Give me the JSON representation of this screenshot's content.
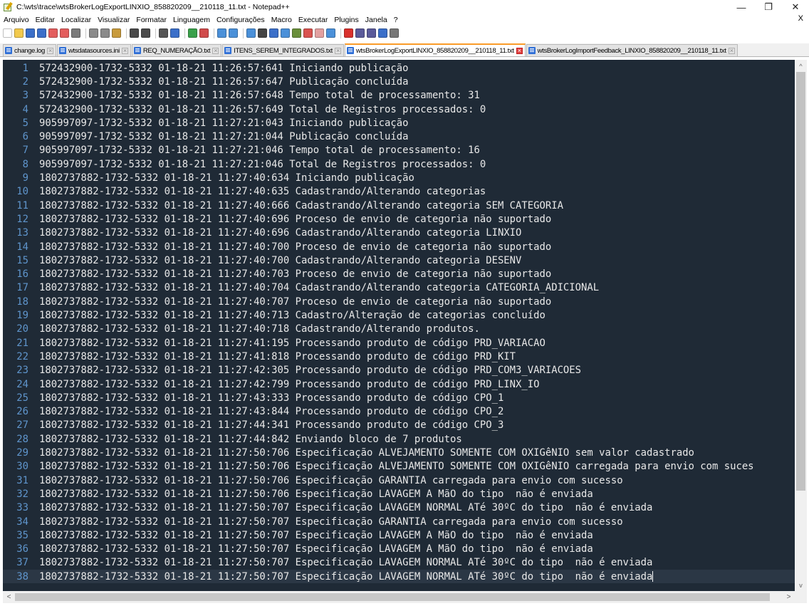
{
  "window": {
    "title": "C:\\wts\\trace\\wtsBrokerLogExportLINXIO_858820209__210118_11.txt - Notepad++",
    "minimize": "—",
    "maximize": "❐",
    "close": "✕"
  },
  "menu": {
    "items": [
      "Arquivo",
      "Editar",
      "Localizar",
      "Visualizar",
      "Formatar",
      "Linguagem",
      "Configurações",
      "Macro",
      "Executar",
      "Plugins",
      "Janela",
      "?"
    ],
    "close_doc": "X"
  },
  "toolbar": {
    "icons": [
      {
        "name": "new-file-icon",
        "color": "#ffffff"
      },
      {
        "name": "open-file-icon",
        "color": "#f2c94c"
      },
      {
        "name": "save-icon",
        "color": "#3b6fc9"
      },
      {
        "name": "save-all-icon",
        "color": "#3b6fc9"
      },
      {
        "name": "close-file-icon",
        "color": "#e35d5d"
      },
      {
        "name": "close-all-icon",
        "color": "#e35d5d"
      },
      {
        "name": "print-icon",
        "color": "#7a7a7a"
      },
      {
        "sep": true
      },
      {
        "name": "cut-icon",
        "color": "#8a8a8a"
      },
      {
        "name": "copy-icon",
        "color": "#8a8a8a"
      },
      {
        "name": "paste-icon",
        "color": "#c89b3c"
      },
      {
        "sep": true
      },
      {
        "name": "undo-icon",
        "color": "#4a4a4a"
      },
      {
        "name": "redo-icon",
        "color": "#4a4a4a"
      },
      {
        "sep": true
      },
      {
        "name": "find-icon",
        "color": "#555555"
      },
      {
        "name": "replace-icon",
        "color": "#3b6fc9"
      },
      {
        "sep": true
      },
      {
        "name": "zoom-in-icon",
        "color": "#3aa04a"
      },
      {
        "name": "zoom-out-icon",
        "color": "#d04a4a"
      },
      {
        "sep": true
      },
      {
        "name": "sync-vertical-icon",
        "color": "#4a90d9"
      },
      {
        "name": "sync-horizontal-icon",
        "color": "#4a90d9"
      },
      {
        "sep": true
      },
      {
        "name": "word-wrap-icon",
        "color": "#4a90d9"
      },
      {
        "name": "show-all-chars-icon",
        "color": "#444444"
      },
      {
        "name": "indent-guide-icon",
        "color": "#3b6fc9"
      },
      {
        "name": "language-icon",
        "color": "#4a90d9"
      },
      {
        "name": "doc-map-icon",
        "color": "#6a8f3a"
      },
      {
        "name": "function-list-icon",
        "color": "#d9534f"
      },
      {
        "name": "folder-workspace-icon",
        "color": "#e2a0a0"
      },
      {
        "name": "monitoring-icon",
        "color": "#4a90d9"
      },
      {
        "sep": true
      },
      {
        "name": "record-macro-icon",
        "color": "#d9302c"
      },
      {
        "name": "stop-macro-icon",
        "color": "#5a5a9a"
      },
      {
        "name": "play-macro-icon",
        "color": "#5a5a9a"
      },
      {
        "name": "run-macro-multiple-icon",
        "color": "#3b6fc9"
      },
      {
        "name": "save-macro-icon",
        "color": "#777777"
      }
    ]
  },
  "tabs": [
    {
      "label": "change.log",
      "active": false
    },
    {
      "label": "wtsdatasources.ini",
      "active": false
    },
    {
      "label": "REQ_NUMERAÇÃO.txt",
      "active": false
    },
    {
      "label": "ITENS_SEREM_INTEGRADOS.txt",
      "active": false
    },
    {
      "label": "wtsBrokerLogExportLINXIO_858820209__210118_11.txt",
      "active": true
    },
    {
      "label": "wtsBrokerLogImportFeedback_LINXIO_858820209__210118_11.txt",
      "active": false
    }
  ],
  "editor": {
    "current_line": 38,
    "lines": [
      {
        "n": "1",
        "text": "572432900-1732-5332 01-18-21 11:26:57:641 Iniciando publicação"
      },
      {
        "n": "2",
        "text": "572432900-1732-5332 01-18-21 11:26:57:647 Publicação concluída"
      },
      {
        "n": "3",
        "text": "572432900-1732-5332 01-18-21 11:26:57:648 Tempo total de processamento: 31"
      },
      {
        "n": "4",
        "text": "572432900-1732-5332 01-18-21 11:26:57:649 Total de Registros processados: 0"
      },
      {
        "n": "5",
        "text": "905997097-1732-5332 01-18-21 11:27:21:043 Iniciando publicação"
      },
      {
        "n": "6",
        "text": "905997097-1732-5332 01-18-21 11:27:21:044 Publicação concluída"
      },
      {
        "n": "7",
        "text": "905997097-1732-5332 01-18-21 11:27:21:046 Tempo total de processamento: 16"
      },
      {
        "n": "8",
        "text": "905997097-1732-5332 01-18-21 11:27:21:046 Total de Registros processados: 0"
      },
      {
        "n": "9",
        "text": "1802737882-1732-5332 01-18-21 11:27:40:634 Iniciando publicação"
      },
      {
        "n": "10",
        "text": "1802737882-1732-5332 01-18-21 11:27:40:635 Cadastrando/Alterando categorias"
      },
      {
        "n": "11",
        "text": "1802737882-1732-5332 01-18-21 11:27:40:666 Cadastrando/Alterando categoria SEM CATEGORIA"
      },
      {
        "n": "12",
        "text": "1802737882-1732-5332 01-18-21 11:27:40:696 Proceso de envio de categoria não suportado"
      },
      {
        "n": "13",
        "text": "1802737882-1732-5332 01-18-21 11:27:40:696 Cadastrando/Alterando categoria LINXIO"
      },
      {
        "n": "14",
        "text": "1802737882-1732-5332 01-18-21 11:27:40:700 Proceso de envio de categoria não suportado"
      },
      {
        "n": "15",
        "text": "1802737882-1732-5332 01-18-21 11:27:40:700 Cadastrando/Alterando categoria DESENV"
      },
      {
        "n": "16",
        "text": "1802737882-1732-5332 01-18-21 11:27:40:703 Proceso de envio de categoria não suportado"
      },
      {
        "n": "17",
        "text": "1802737882-1732-5332 01-18-21 11:27:40:704 Cadastrando/Alterando categoria CATEGORIA_ADICIONAL"
      },
      {
        "n": "18",
        "text": "1802737882-1732-5332 01-18-21 11:27:40:707 Proceso de envio de categoria não suportado"
      },
      {
        "n": "19",
        "text": "1802737882-1732-5332 01-18-21 11:27:40:713 Cadastro/Alteração de categorias concluído"
      },
      {
        "n": "20",
        "text": "1802737882-1732-5332 01-18-21 11:27:40:718 Cadastrando/Alterando produtos."
      },
      {
        "n": "21",
        "text": "1802737882-1732-5332 01-18-21 11:27:41:195 Processando produto de código PRD_VARIACAO"
      },
      {
        "n": "22",
        "text": "1802737882-1732-5332 01-18-21 11:27:41:818 Processando produto de código PRD_KIT"
      },
      {
        "n": "23",
        "text": "1802737882-1732-5332 01-18-21 11:27:42:305 Processando produto de código PRD_COM3_VARIACOES"
      },
      {
        "n": "24",
        "text": "1802737882-1732-5332 01-18-21 11:27:42:799 Processando produto de código PRD_LINX_IO"
      },
      {
        "n": "25",
        "text": "1802737882-1732-5332 01-18-21 11:27:43:333 Processando produto de código CPO_1"
      },
      {
        "n": "26",
        "text": "1802737882-1732-5332 01-18-21 11:27:43:844 Processando produto de código CPO_2"
      },
      {
        "n": "27",
        "text": "1802737882-1732-5332 01-18-21 11:27:44:341 Processando produto de código CPO_3"
      },
      {
        "n": "28",
        "text": "1802737882-1732-5332 01-18-21 11:27:44:842 Enviando bloco de 7 produtos"
      },
      {
        "n": "29",
        "text": "1802737882-1732-5332 01-18-21 11:27:50:706 Especificação ALVEJAMENTO SOMENTE COM OXIGêNIO sem valor cadastrado"
      },
      {
        "n": "30",
        "text": "1802737882-1732-5332 01-18-21 11:27:50:706 Especificação ALVEJAMENTO SOMENTE COM OXIGêNIO carregada para envio com suces"
      },
      {
        "n": "31",
        "text": "1802737882-1732-5332 01-18-21 11:27:50:706 Especificação GARANTIA carregada para envio com sucesso"
      },
      {
        "n": "32",
        "text": "1802737882-1732-5332 01-18-21 11:27:50:706 Especificação LAVAGEM A MãO do tipo  não é enviada"
      },
      {
        "n": "33",
        "text": "1802737882-1732-5332 01-18-21 11:27:50:707 Especificação LAVAGEM NORMAL ATé 30ºC do tipo  não é enviada"
      },
      {
        "n": "34",
        "text": "1802737882-1732-5332 01-18-21 11:27:50:707 Especificação GARANTIA carregada para envio com sucesso"
      },
      {
        "n": "35",
        "text": "1802737882-1732-5332 01-18-21 11:27:50:707 Especificação LAVAGEM A MãO do tipo  não é enviada"
      },
      {
        "n": "36",
        "text": "1802737882-1732-5332 01-18-21 11:27:50:707 Especificação LAVAGEM A MãO do tipo  não é enviada"
      },
      {
        "n": "37",
        "text": "1802737882-1732-5332 01-18-21 11:27:50:707 Especificação LAVAGEM NORMAL ATé 30ºC do tipo  não é enviada"
      },
      {
        "n": "38",
        "text": "1802737882-1732-5332 01-18-21 11:27:50:707 Especificação LAVAGEM NORMAL ATé 30ºC do tipo  não é enviada"
      }
    ]
  },
  "scrollbars": {
    "up_arrow": "^",
    "down_arrow": "v",
    "left_arrow": "<",
    "right_arrow": ">"
  }
}
